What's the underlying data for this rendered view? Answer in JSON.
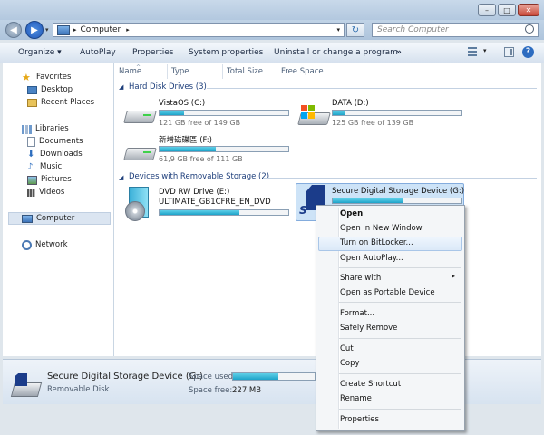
{
  "window": {
    "caption_min": "–",
    "caption_max": "□",
    "caption_close": "✕"
  },
  "address_bar": {
    "breadcrumb": "Computer",
    "search_placeholder": "Search Computer"
  },
  "toolbar": {
    "organize": "Organize ▾",
    "autoplay": "AutoPlay",
    "properties": "Properties",
    "system_properties": "System properties",
    "uninstall": "Uninstall or change a program",
    "more": "»"
  },
  "nav": {
    "favorites": "Favorites",
    "desktop": "Desktop",
    "recent_places": "Recent Places",
    "libraries": "Libraries",
    "documents": "Documents",
    "downloads": "Downloads",
    "music": "Music",
    "pictures": "Pictures",
    "videos": "Videos",
    "computer": "Computer",
    "network": "Network"
  },
  "columns": {
    "name": "Name",
    "type": "Type",
    "total_size": "Total Size",
    "free_space": "Free Space"
  },
  "groups": {
    "hard_disks": "Hard Disk Drives (3)",
    "removable": "Devices with Removable Storage (2)"
  },
  "drives": {
    "c": {
      "name": "VistaOS (C:)",
      "free": "121 GB free of 149 GB",
      "used_fraction": 0.19
    },
    "d": {
      "name": "DATA (D:)",
      "free": "125 GB free of 139 GB",
      "used_fraction": 0.1
    },
    "f": {
      "name": "新增磁碟區 (F:)",
      "free": "61,9 GB free of 111 GB",
      "used_fraction": 0.44
    },
    "e": {
      "name": "DVD RW Drive (E:)",
      "label": "ULTIMATE_GB1CFRE_EN_DVD",
      "used_fraction": 0.62
    },
    "g": {
      "name": "Secure Digital Storage Device (G:)",
      "used_fraction": 0.55
    }
  },
  "details": {
    "name": "Secure Digital Storage Device (G:)",
    "type": "Removable Disk",
    "space_used_label": "Space used:",
    "space_free_label": "Space free:",
    "space_free_value": "227 MB",
    "used_fraction": 0.55
  },
  "context_menu": {
    "open": "Open",
    "open_new_window": "Open in New Window",
    "bitlocker": "Turn on BitLocker...",
    "autoplay": "Open AutoPlay...",
    "share_with": "Share with",
    "portable": "Open as Portable Device",
    "format": "Format...",
    "safely_remove": "Safely Remove",
    "cut": "Cut",
    "copy": "Copy",
    "create_shortcut": "Create Shortcut",
    "rename": "Rename",
    "properties": "Properties",
    "submenu_arrow": "▸"
  },
  "colors": {
    "accent": "#1da3c9",
    "selection": "#cde3f7"
  }
}
